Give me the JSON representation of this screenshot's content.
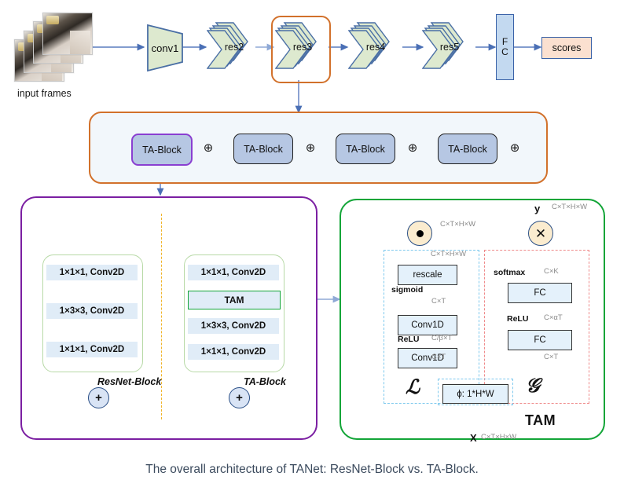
{
  "figure": {
    "caption": "The overall architecture of TANet: ResNet-Block vs. TA-Block."
  },
  "backbone": {
    "input_label": "input frames",
    "stages": [
      {
        "id": "conv1",
        "label": "conv1",
        "shape": "trapezoid"
      },
      {
        "id": "res2",
        "label": "res2",
        "shape": "chevron-stack"
      },
      {
        "id": "res3",
        "label": "res3",
        "shape": "chevron-stack",
        "highlighted": true
      },
      {
        "id": "res4",
        "label": "res4",
        "shape": "chevron-stack"
      },
      {
        "id": "res5",
        "label": "res5",
        "shape": "chevron-stack"
      }
    ],
    "fc_label_line1": "F",
    "fc_label_line2": "C",
    "output_label": "scores"
  },
  "chain": {
    "blocks": [
      {
        "label": "TA-Block",
        "highlighted": true
      },
      {
        "label": "TA-Block",
        "highlighted": false
      },
      {
        "label": "TA-Block",
        "highlighted": false
      },
      {
        "label": "TA-Block",
        "highlighted": false
      }
    ],
    "add_symbol": "⊕"
  },
  "resnet_panel": {
    "block_name": "ResNet-Block",
    "layers": [
      "1×1×1, Conv2D",
      "1×3×3, Conv2D",
      "1×1×1, Conv2D"
    ],
    "add_symbol": "+"
  },
  "tablock_panel": {
    "block_name": "TA-Block",
    "layers": [
      "1×1×1, Conv2D",
      "TAM",
      "1×3×3, Conv2D",
      "1×1×1, Conv2D"
    ],
    "tam_layer_label": "TAM",
    "add_symbol": "+"
  },
  "tam": {
    "title": "TAM",
    "input_label": "X",
    "output_label": "y",
    "input_dim": "C×T×H×W",
    "output_dim": "C×T×H×W",
    "branch_local_symbol": "ℒ",
    "branch_global_symbol": "𝒢",
    "phi_box": "ϕ: 1*H*W",
    "mul_elementwise_symbol": "⊙",
    "mul_symbol": "✕",
    "dim_after_elementwise": "C×T×H×W",
    "local_branch": {
      "boxes": [
        "rescale",
        "Conv1D",
        "Conv1D"
      ],
      "dims": [
        "C×T×H×W",
        "C×T",
        "C/β×T",
        "C×T"
      ],
      "activations": [
        "sigmoid",
        "ReLU"
      ]
    },
    "global_branch": {
      "boxes": [
        "FC",
        "FC"
      ],
      "dims": [
        "C×K",
        "C×αT",
        "C×T"
      ],
      "activations": [
        "softmax",
        "ReLU"
      ]
    }
  },
  "colors": {
    "stage_fill": "#dde9cf",
    "stage_stroke": "#4a6fa5",
    "arrow": "#5a7bbf",
    "highlight_orange": "#d2712b",
    "highlight_purple": "#7b1fa2",
    "highlight_green": "#13a538",
    "chain_bg": "#f2f7fb",
    "tablock_fill": "#b6c7e3",
    "conv_fill": "#e0ecf7",
    "fc_fill": "#c3d9f0",
    "scores_fill": "#fbe0d0",
    "op_fill": "#fbeccf",
    "dash_blue": "#7ec9ee",
    "dash_red": "#ef8a8a",
    "divider_yellow": "#f0b429"
  }
}
